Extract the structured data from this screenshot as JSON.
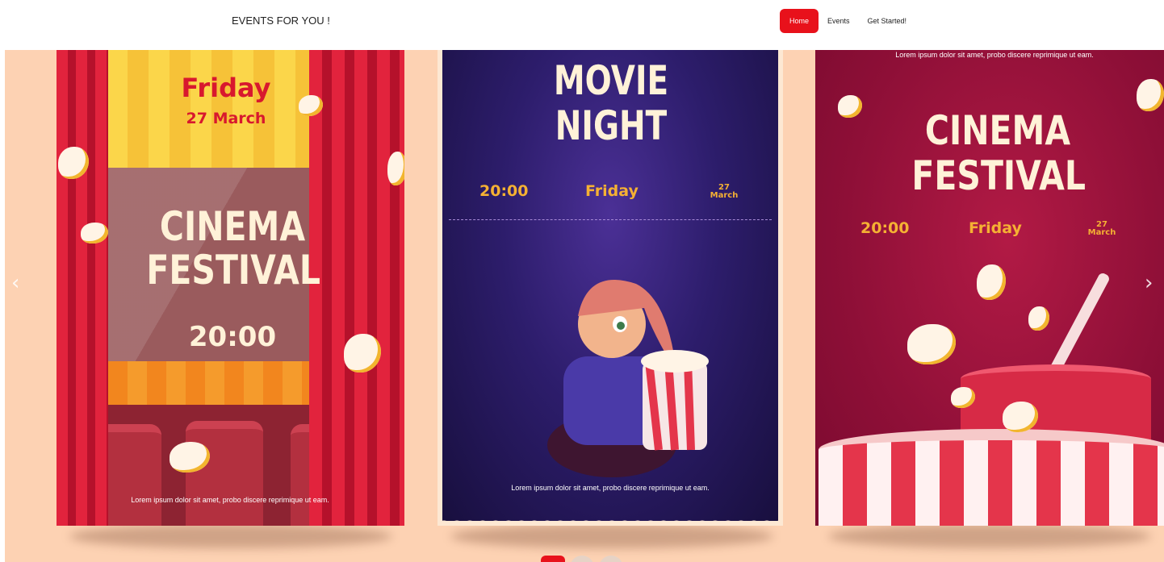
{
  "navbar": {
    "brand": "EVENTS FOR YOU !",
    "links": [
      {
        "label": "Home",
        "active": true
      },
      {
        "label": "Events",
        "active": false
      },
      {
        "label": "Get Started!",
        "active": false
      }
    ],
    "accent_color": "#e8111b"
  },
  "carousel": {
    "background_color": "#fdd2b3",
    "prev_icon": "chevron-left-icon",
    "next_icon": "chevron-right-icon",
    "indicators": [
      true,
      false,
      false
    ],
    "slides": [
      {
        "day": "Friday",
        "date": "27 March",
        "title_line1": "CINEMA",
        "title_line2": "FESTIVAL",
        "time": "20:00",
        "caption": "Lorem ipsum dolor sit amet, probo discere reprimique ut eam."
      },
      {
        "title_line1": "MOVIE",
        "title_line2": "NIGHT",
        "time": "20:00",
        "day": "Friday",
        "date_num": "27",
        "date_month": "March",
        "caption": "Lorem ipsum dolor sit amet, probo discere reprimique ut eam."
      },
      {
        "caption": "Lorem ipsum dolor sit amet, probo discere reprimique ut eam.",
        "title_line1": "CINEMA",
        "title_line2": "FESTIVAL",
        "time": "20:00",
        "day": "Friday",
        "date_num": "27",
        "date_month": "March"
      }
    ]
  }
}
